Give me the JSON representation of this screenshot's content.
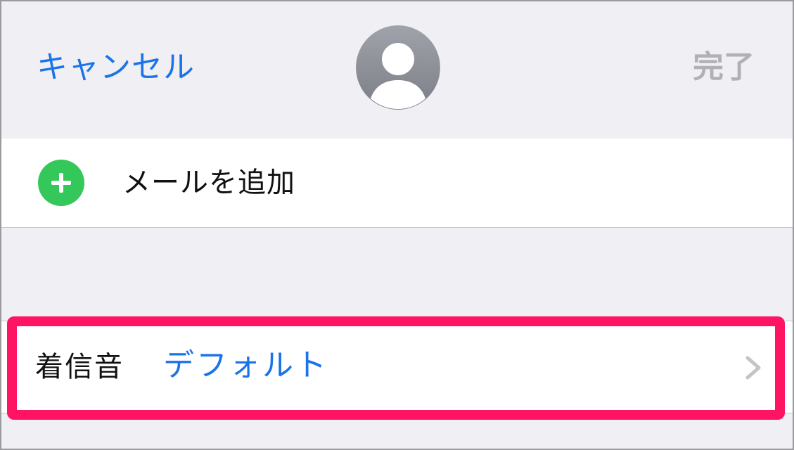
{
  "header": {
    "cancel_label": "キャンセル",
    "done_label": "完了",
    "avatar_icon": "person-avatar-icon"
  },
  "email_row": {
    "label": "メールを追加",
    "icon": "add-circle-icon",
    "icon_color": "#34c759"
  },
  "ringtone_row": {
    "label": "着信音",
    "value": "デフォルト",
    "icon": "chevron-right-icon"
  },
  "colors": {
    "accent": "#1a73e8",
    "highlight": "#ff1463",
    "background": "#efeff4",
    "disabled": "#b0b0b5"
  }
}
